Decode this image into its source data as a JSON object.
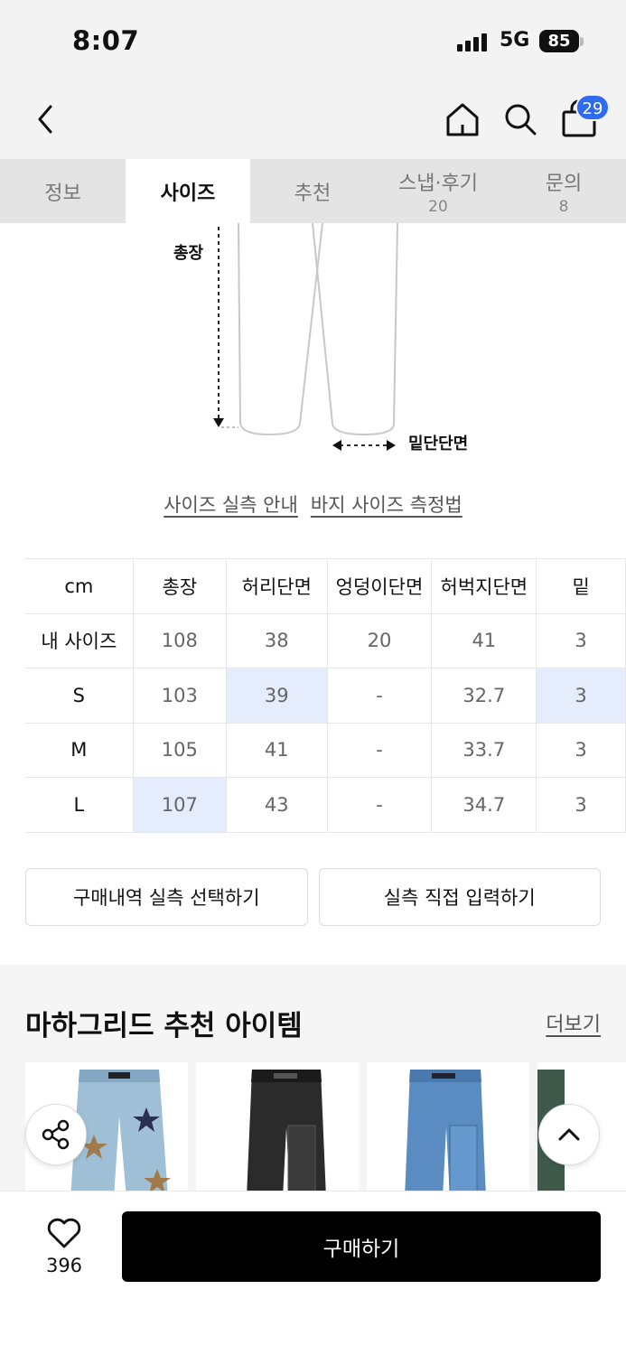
{
  "status_bar": {
    "time": "8:07",
    "network": "5G",
    "battery": "85"
  },
  "header": {
    "cart_count": "29"
  },
  "tabs": [
    {
      "label": "정보",
      "sub": ""
    },
    {
      "label": "사이즈",
      "sub": ""
    },
    {
      "label": "추천",
      "sub": ""
    },
    {
      "label": "스냅·후기",
      "sub": "20"
    },
    {
      "label": "문의",
      "sub": "8"
    }
  ],
  "active_tab": "사이즈",
  "diagram": {
    "length_label": "총장",
    "hem_label": "밑단단면"
  },
  "links": {
    "size_guide": "사이즈 실측 안내",
    "measure_guide": "바지 사이즈 측정법"
  },
  "size_table": {
    "headers": [
      "cm",
      "총장",
      "허리단면",
      "엉덩이단면",
      "허벅지단면",
      "밑"
    ],
    "rows": [
      {
        "label": "내 사이즈",
        "values": [
          "108",
          "38",
          "20",
          "41",
          "3"
        ]
      },
      {
        "label": "S",
        "values": [
          "103",
          "39",
          "-",
          "32.7",
          "3"
        ]
      },
      {
        "label": "M",
        "values": [
          "105",
          "41",
          "-",
          "33.7",
          "3"
        ]
      },
      {
        "label": "L",
        "values": [
          "107",
          "43",
          "-",
          "34.7",
          "3"
        ]
      }
    ]
  },
  "buttons": {
    "select_purchase": "구매내역 실측 선택하기",
    "direct_input": "실측 직접 입력하기"
  },
  "recommend": {
    "title": "마하그리드 추천 아이템",
    "more": "더보기"
  },
  "bottom": {
    "like_count": "396",
    "buy": "구매하기"
  },
  "colors": {
    "accent": "#2f6bf0",
    "highlight": "#e5edfd",
    "buy_button": "#000000"
  }
}
